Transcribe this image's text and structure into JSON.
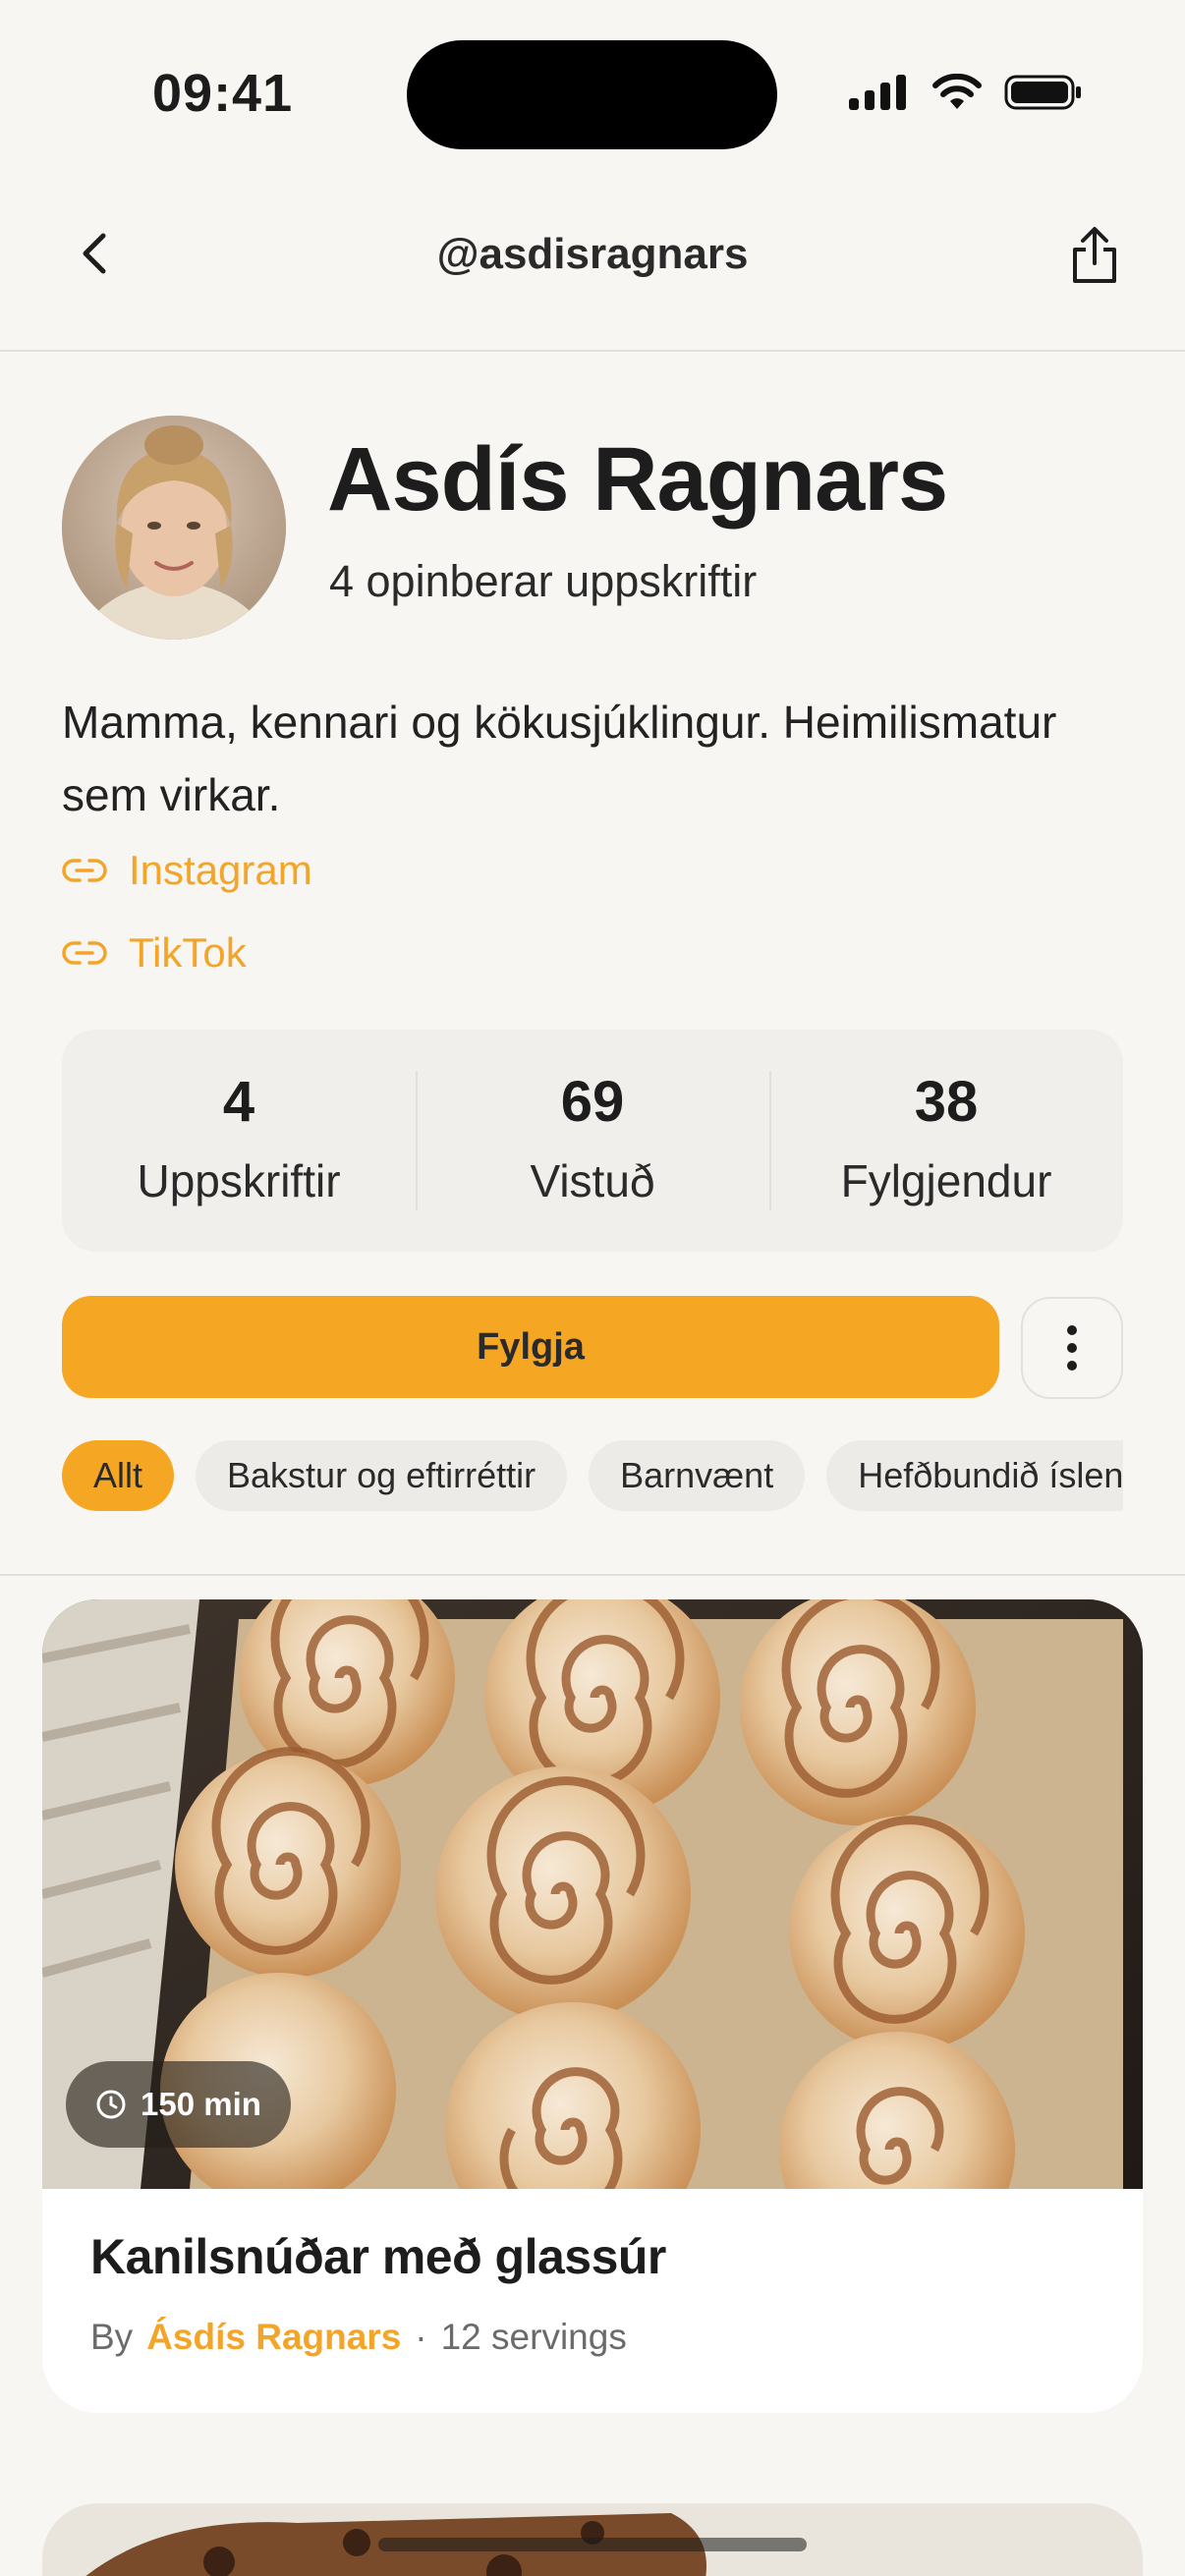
{
  "status": {
    "time": "09:41"
  },
  "nav": {
    "title": "@asdisragnars"
  },
  "profile": {
    "name": "Asdís Ragnars",
    "subtitle": "4 opinberar uppskriftir",
    "bio": "Mamma, kennari og kökusjúklingur. Heimilismatur sem virkar.",
    "links": [
      {
        "label": "Instagram",
        "icon": "link-icon"
      },
      {
        "label": "TikTok",
        "icon": "link-icon"
      }
    ]
  },
  "stats": [
    {
      "value": "4",
      "label": "Uppskriftir"
    },
    {
      "value": "69",
      "label": "Vistuð"
    },
    {
      "value": "38",
      "label": "Fylgjendur"
    }
  ],
  "actions": {
    "follow_label": "Fylgja",
    "more_icon": "more-vertical-icon"
  },
  "filters": {
    "selected": "Allt",
    "items": [
      "Allt",
      "Bakstur og eftirréttir",
      "Barnvænt",
      "Hefðbundið íslenskt"
    ]
  },
  "recipes": [
    {
      "time": "150 min",
      "title": "Kanilsnúðar með glassúr",
      "by_label": "By",
      "author": "Ásdís Ragnars",
      "servings": "12 servings"
    }
  ],
  "colors": {
    "accent": "#f5a623",
    "link": "#f2a52a",
    "background": "#f7f6f3",
    "card": "#ffffff"
  }
}
